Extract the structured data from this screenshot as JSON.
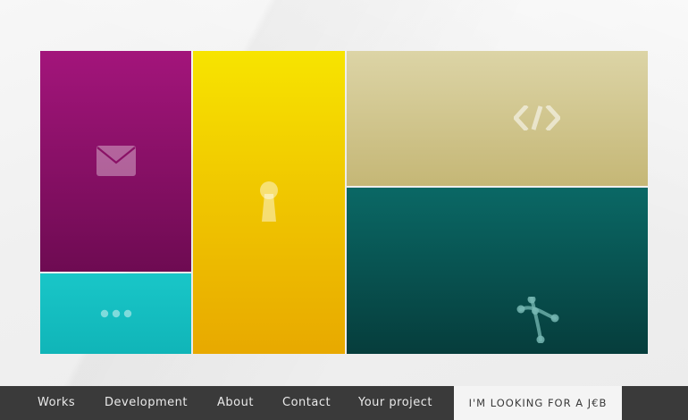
{
  "nav": {
    "items": [
      {
        "label": "Works"
      },
      {
        "label": "Development"
      },
      {
        "label": "About"
      },
      {
        "label": "Contact"
      },
      {
        "label": "Your project"
      }
    ],
    "cta_label": "I'M LOOKING FOR A J€B"
  },
  "tiles": [
    {
      "name": "mail",
      "icon": "envelope-icon",
      "color_top": "#a3157b",
      "color_bottom": "#6e0b52"
    },
    {
      "name": "more",
      "icon": "dots-icon",
      "color_top": "#19c6c8",
      "color_bottom": "#10b5b8"
    },
    {
      "name": "lock",
      "icon": "keyhole-icon",
      "color_top": "#f7e400",
      "color_bottom": "#e8a900"
    },
    {
      "name": "code",
      "icon": "code-icon",
      "color_top": "#dcd4a6",
      "color_bottom": "#c5b776"
    },
    {
      "name": "vector",
      "icon": "bezier-pen-icon",
      "color_top": "#0a6865",
      "color_bottom": "#063d3c"
    }
  ],
  "colors": {
    "navbar": "#3a3a3a",
    "nav_text": "#eaeaea",
    "cta_background": "#f4f4f4",
    "page_background": "#f2f2f2"
  }
}
